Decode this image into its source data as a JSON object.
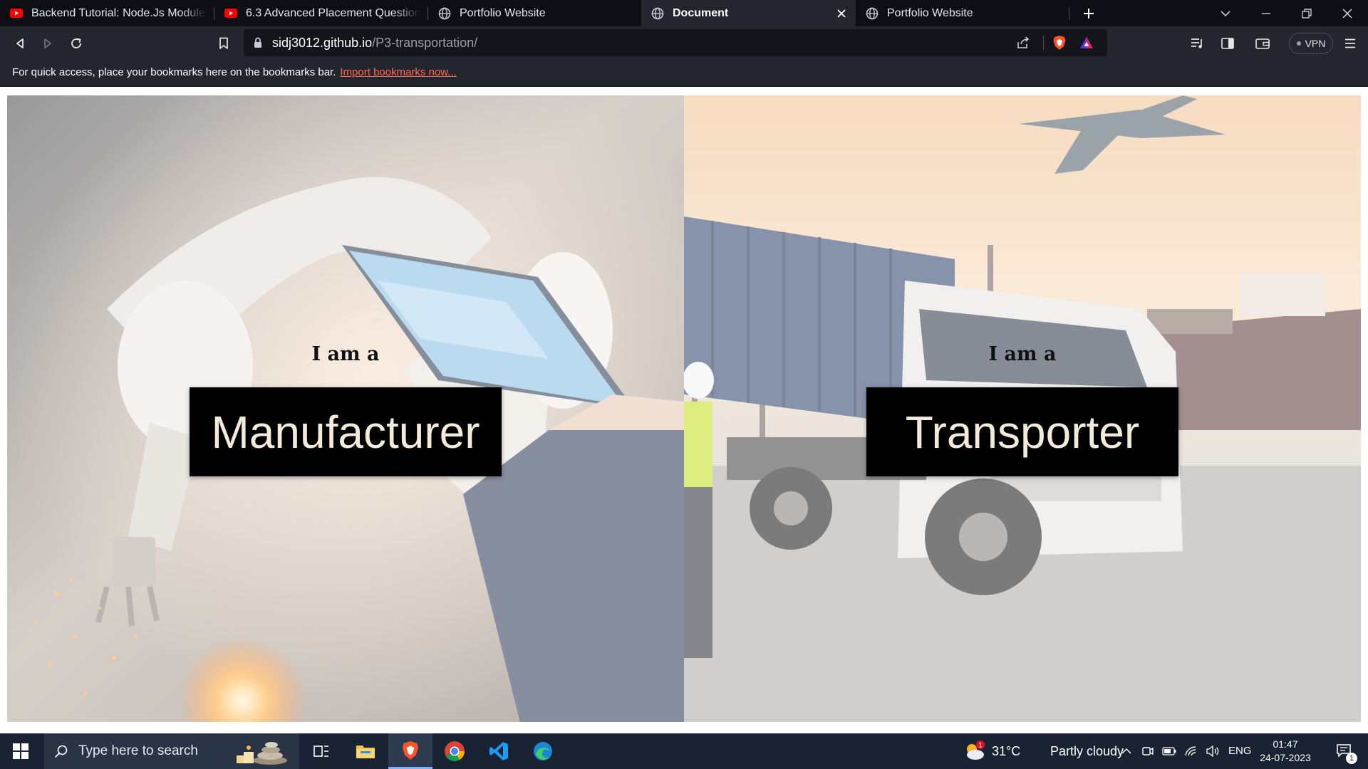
{
  "browser": {
    "tabs": [
      {
        "title": "Backend Tutorial: Node.Js Modules wi",
        "favicon": "youtube-icon",
        "active": false
      },
      {
        "title": "6.3 Advanced Placement Questions on",
        "favicon": "youtube-icon",
        "active": false
      },
      {
        "title": "Portfolio Website",
        "favicon": "globe-icon",
        "active": false
      },
      {
        "title": "Document",
        "favicon": "globe-icon",
        "active": true
      },
      {
        "title": "Portfolio Website",
        "favicon": "globe-icon",
        "active": false
      }
    ],
    "url_host": "sidj3012.github.io",
    "url_path": "/P3-transportation/",
    "vpn_label": "VPN",
    "bookmarks_message": "For quick access, place your bookmarks here on the bookmarks bar.",
    "bookmarks_link": "Import bookmarks now..."
  },
  "page": {
    "left": {
      "prefix": "I am a",
      "role": "Manufacturer"
    },
    "right": {
      "prefix": "I am a",
      "role": "Transporter"
    }
  },
  "taskbar": {
    "search_placeholder": "Type here to search",
    "weather_temp": "31°C",
    "weather_desc": "Partly cloudy",
    "language": "ENG",
    "time": "01:47",
    "date": "24-07-2023",
    "notification_count": "1"
  },
  "colors": {
    "tab_strip": "#0e0f14",
    "toolbar": "#24262f",
    "bookmark_link": "#ff6a4d",
    "role_button_bg": "#000000",
    "role_button_text": "#f3ead9",
    "taskbar": "#1a2333"
  }
}
